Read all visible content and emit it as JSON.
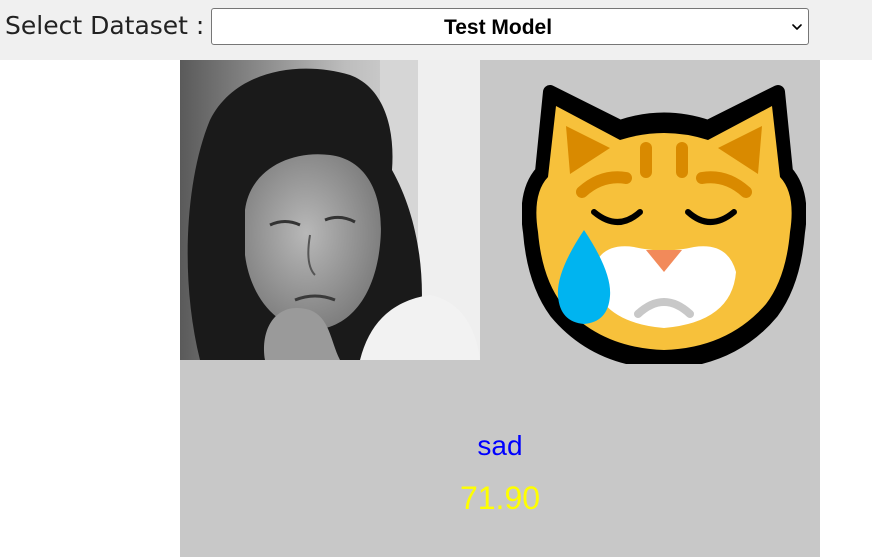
{
  "header": {
    "select_label": "Select Dataset :",
    "dataset_select": {
      "selected": "Test Model"
    }
  },
  "result": {
    "photo": {
      "description_icon": "face-photo",
      "tone": "grayscale"
    },
    "emoji_icon": "crying-cat-face-icon",
    "emotion_label": "sad",
    "score": "71.90",
    "colors": {
      "label": "#0000ff",
      "score": "#ffff00",
      "panel": "#c8c8c8"
    }
  }
}
